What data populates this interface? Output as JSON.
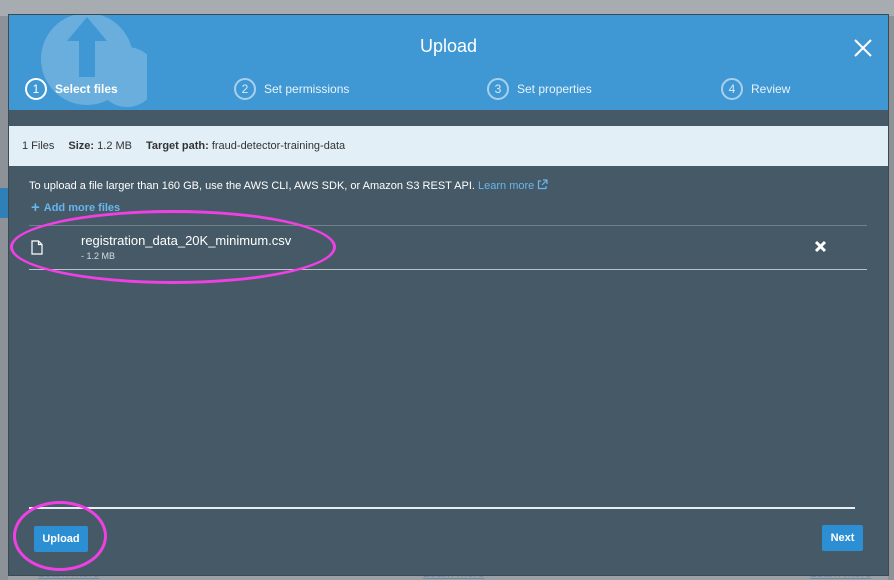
{
  "modal": {
    "title": "Upload"
  },
  "steps": [
    {
      "number": "1",
      "label": "Select files",
      "active": true
    },
    {
      "number": "2",
      "label": "Set permissions",
      "active": false
    },
    {
      "number": "3",
      "label": "Set properties",
      "active": false
    },
    {
      "number": "4",
      "label": "Review",
      "active": false
    }
  ],
  "info_bar": {
    "files_count": "1 Files",
    "size_label": "Size:",
    "size_value": "1.2 MB",
    "target_label": "Target path:",
    "target_value": "fraud-detector-training-data"
  },
  "hint": {
    "text": "To upload a file larger than 160 GB, use the AWS CLI, AWS SDK, or Amazon S3 REST API.",
    "link_label": "Learn more"
  },
  "add_more_label": "Add more files",
  "files": [
    {
      "name": "registration_data_20K_minimum.csv",
      "size": "- 1.2 MB"
    }
  ],
  "buttons": {
    "upload": "Upload",
    "next": "Next"
  },
  "background": {
    "learn_more": "Learn more"
  },
  "colors": {
    "header_blue": "#3f98d4",
    "body_slate": "#455a66",
    "button_blue": "#2d8fd3",
    "link_blue": "#67b6f0",
    "annotation_magenta": "#f040e4"
  },
  "icons": {
    "close": "close-icon",
    "file": "file-icon",
    "remove": "remove-x-icon",
    "external": "external-link-icon",
    "cloud": "cloud-upload-icon"
  }
}
